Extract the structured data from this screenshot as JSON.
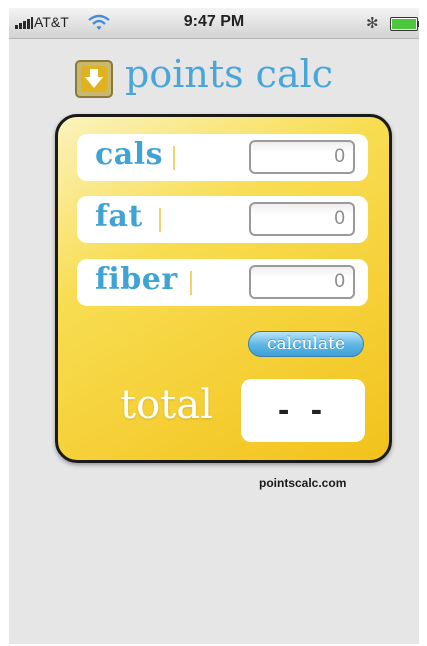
{
  "status_bar": {
    "carrier": "AT&T",
    "time": "9:47 PM",
    "bluetooth_glyph": "✻",
    "signal_icon": "signal-bars-icon",
    "wifi_icon": "wifi-icon",
    "battery_icon": "battery-icon"
  },
  "header": {
    "title": "points calc",
    "logo_icon": "down-arrow-icon"
  },
  "form": {
    "fields": [
      {
        "label": "cals",
        "value": "0"
      },
      {
        "label": "fat",
        "value": "0"
      },
      {
        "label": "fiber",
        "value": "0"
      }
    ],
    "calculate_label": "calculate"
  },
  "result": {
    "label": "total",
    "value": "- -"
  },
  "footer": {
    "site": "pointscalc.com"
  },
  "colors": {
    "accent_blue": "#48a6d8",
    "card_yellow": "#f8dd52",
    "card_border": "#1a1a1a",
    "screen_bg": "#e6e6e6"
  }
}
